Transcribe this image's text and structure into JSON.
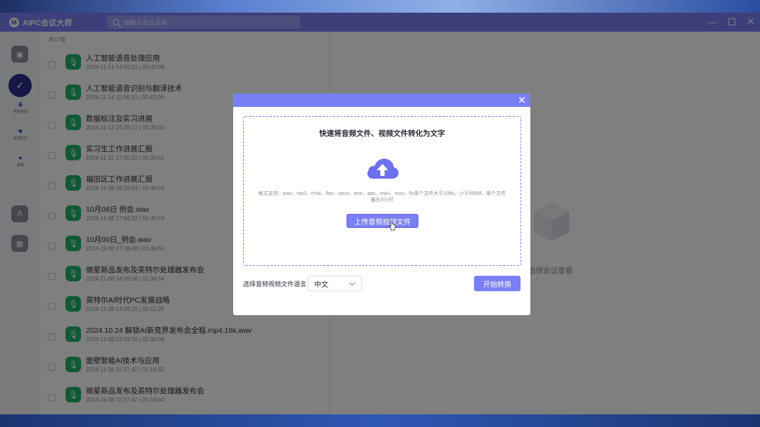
{
  "app": {
    "logo_glyph": "M",
    "title": "AIPC会议大师"
  },
  "search": {
    "placeholder": "请输入会议名称"
  },
  "window_controls": {
    "minimize": "—",
    "close": "✕"
  },
  "sidebar": {
    "sub_items": [
      {
        "label": "实时会议",
        "icon": "people-icon",
        "glyph": "♟"
      },
      {
        "label": "本地文件",
        "icon": "folder-icon",
        "glyph": "■"
      },
      {
        "label": "系统",
        "icon": "chat-icon",
        "glyph": "●"
      }
    ]
  },
  "meeting_list": {
    "count_label": "共17条",
    "items": [
      {
        "title": "人工智能语音处理应用",
        "date": "2024-11-14 14:55:21",
        "duration": "00:43:08"
      },
      {
        "title": "人工智能语音识别与翻译技术",
        "date": "2024-11-14 11:56:33",
        "duration": "00:43:08"
      },
      {
        "title": "数据标注及实习进展",
        "date": "2024-11-12 15:25:17",
        "duration": "00:30:03"
      },
      {
        "title": "实习生工作进展汇报",
        "date": "2024-11-11 17:36:22",
        "duration": "00:30:03"
      },
      {
        "title": "福田区工作进展汇报",
        "date": "2024-11-08 19:35:54",
        "duration": "01:49:53"
      },
      {
        "title": "10月08日 例会.wav",
        "date": "2024-11-08 17:56:22",
        "duration": "01:49:53"
      },
      {
        "title": "10月00日_例会.wav",
        "date": "2024-11-08 17:38:48",
        "duration": "01:49:53"
      },
      {
        "title": "微星新品发布及英特尔处理器发布会",
        "date": "2024-11-08 14:09:06",
        "duration": "01:34:04"
      },
      {
        "title": "英特尔AI时代PC发展战略",
        "date": "2024-11-08 14:06:15",
        "duration": "00:11:28"
      },
      {
        "title": "2024.10.24 解锁AI新竞界发布会全程.mp4.16k.wav",
        "date": "2024-11-08 13:59:16",
        "duration": "01:34:04"
      },
      {
        "title": "面壁智能AI技术与应用",
        "date": "2024-11-08 11:27:42",
        "duration": "01:18:32"
      },
      {
        "title": "微星新品发布及英特尔处理器发布会",
        "date": "2024-11-08 11:27:47",
        "duration": "01:34:04"
      }
    ]
  },
  "detail": {
    "empty_text": "选择会议查看"
  },
  "dialog": {
    "close_glyph": "✕",
    "heading": "快速将音频文件、视频文件转化为文字",
    "format_hint": "格式支持：wav、mp3、m4a、flac、opus、amr、aac、mp4、mov、flv单个文件大于10kb，小于500M，单个文件最长3小时",
    "upload_button": "上传音频视频文件",
    "language_label": "选择音频视频文件语言",
    "language_value": "中文",
    "start_button": "开始转换"
  },
  "colors": {
    "accent": "#7b7ff5",
    "meeting_icon": "#21b36a"
  }
}
